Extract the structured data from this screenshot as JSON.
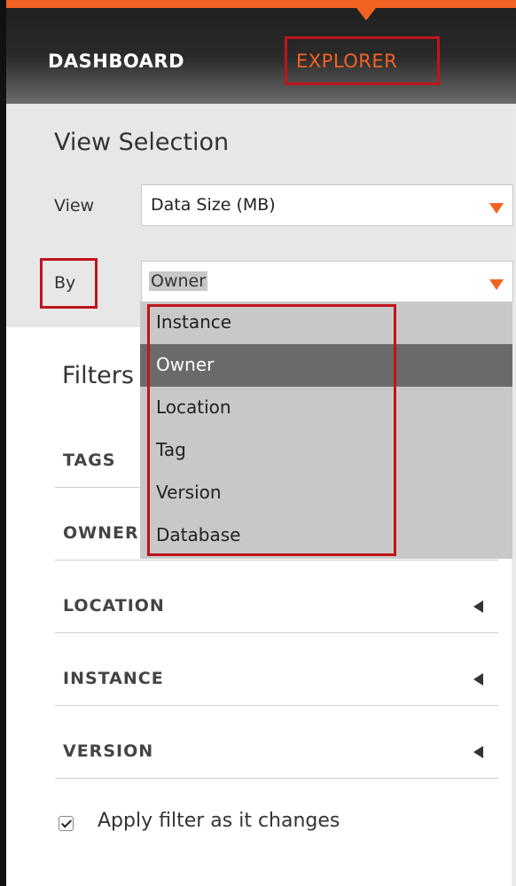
{
  "nav": {
    "dashboard": "DASHBOARD",
    "explorer": "EXPLORER"
  },
  "view_selection": {
    "title": "View Selection",
    "view_label": "View",
    "view_value": "Data Size (MB)",
    "by_label": "By",
    "by_value": "Owner"
  },
  "dropdown": {
    "options": [
      "Instance",
      "Owner",
      "Location",
      "Tag",
      "Version",
      "Database"
    ],
    "selected": "Owner"
  },
  "filters": {
    "title": "Filters",
    "rows": [
      "TAGS",
      "OWNER",
      "LOCATION",
      "INSTANCE",
      "VERSION"
    ],
    "apply_label": "Apply filter as it changes",
    "apply_checked": true
  },
  "colors": {
    "accent": "#f26322",
    "highlight": "#c0141b"
  }
}
